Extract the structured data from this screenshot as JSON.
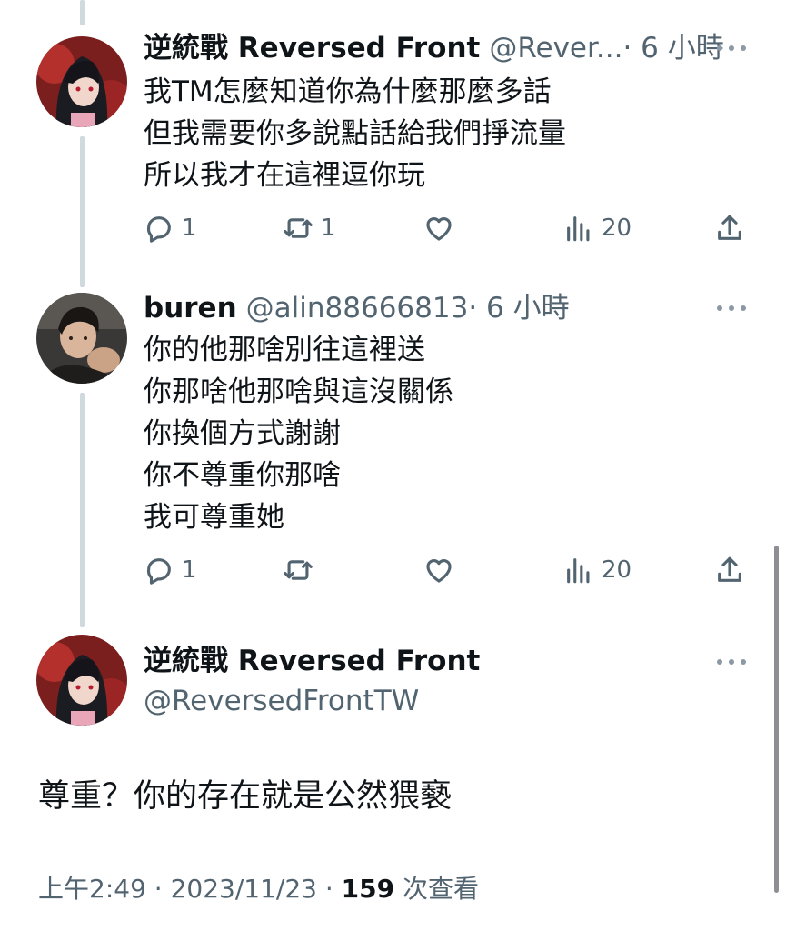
{
  "tweets": [
    {
      "display_name": "逆統戰 Reversed Front",
      "handle": "@Rever...",
      "time": "· 6 小時",
      "lines": [
        "我TM怎麼知道你為什麼那麼多話",
        "但我需要你多說點話給我們掙流量",
        "所以我才在這裡逗你玩"
      ],
      "stats": {
        "replies": "1",
        "retweets": "1",
        "likes": "",
        "views": "20"
      }
    },
    {
      "display_name": "buren",
      "handle": "@alin88666813",
      "time": "· 6 小時",
      "lines": [
        "你的他那啥別往這裡送",
        "你那啥他那啥與這沒關係",
        "你換個方式謝謝",
        "你不尊重你那啥",
        "我可尊重她"
      ],
      "stats": {
        "replies": "1",
        "retweets": "",
        "likes": "",
        "views": "20"
      }
    }
  ],
  "main_tweet": {
    "display_name": "逆統戰 Reversed Front",
    "handle": "@ReversedFrontTW",
    "text": "尊重？你的存在就是公然猥褻",
    "timestamp": "上午2:49 · 2023/11/23 · ",
    "view_count": "159",
    "view_label": " 次查看"
  },
  "icons": [
    "reply-icon",
    "retweet-icon",
    "like-icon",
    "views-icon",
    "share-icon",
    "more-icon"
  ],
  "colors": {
    "text": "#0f1419",
    "secondary": "#536471",
    "thread_line": "#cfd9de"
  }
}
